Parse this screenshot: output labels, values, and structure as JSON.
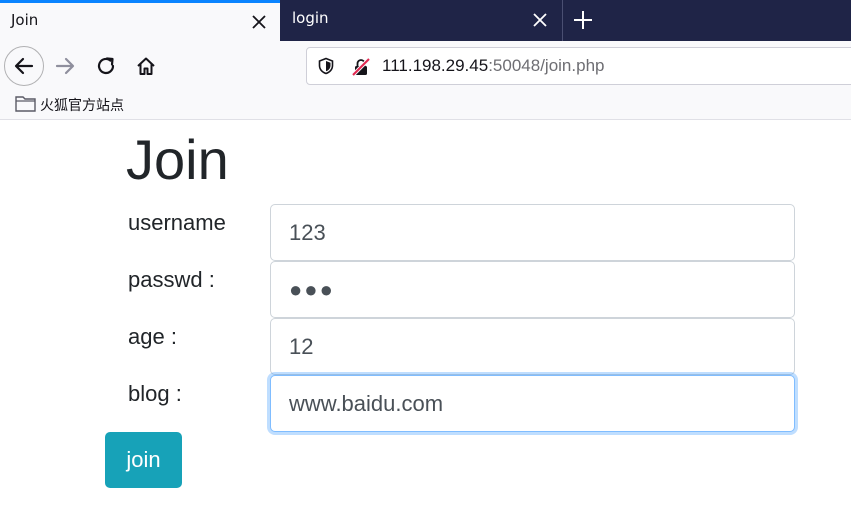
{
  "browser": {
    "tabs": [
      {
        "title": "Join",
        "active": true
      },
      {
        "title": "login",
        "active": false
      }
    ],
    "url": {
      "host": "111.198.29.45",
      "rest": ":50048/join.php"
    },
    "bookmarks": [
      {
        "label": "火狐官方站点",
        "icon": "folder-icon"
      }
    ],
    "icons": {
      "back": "back-arrow-icon",
      "forward": "forward-arrow-icon",
      "reload": "reload-icon",
      "home": "home-icon",
      "shield": "tracking-shield-icon",
      "insecure": "insecure-lock-icon",
      "close": "close-icon",
      "new_tab": "plus-icon"
    },
    "colors": {
      "tabstrip": "#1f2447",
      "active_tab_accent": "#0a84ff",
      "button": "#17a2b8",
      "focus_ring": "#80bdff"
    }
  },
  "page": {
    "title": "Join",
    "fields": [
      {
        "label": "username",
        "value": "123",
        "type": "text"
      },
      {
        "label": "passwd :",
        "value": "●●●",
        "type": "password"
      },
      {
        "label": "age :",
        "value": "12",
        "type": "text"
      },
      {
        "label": "blog :",
        "value": "www.baidu.com",
        "type": "text",
        "focused": true
      }
    ],
    "submit_label": "join"
  }
}
